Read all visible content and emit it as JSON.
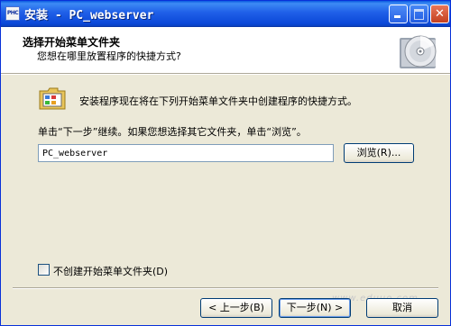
{
  "window": {
    "title": "安装 - PC_webserver",
    "app_icon_text": "PHC"
  },
  "header": {
    "title": "选择开始菜单文件夹",
    "subtitle": "您想在哪里放置程序的快捷方式?"
  },
  "body": {
    "info_text": "安装程序现在将在下列开始菜单文件夹中创建程序的快捷方式。",
    "instruction_text": "单击“下一步”继续。如果您想选择其它文件夹，单击“浏览”。",
    "folder_input_value": "PC_webserver",
    "browse_label": "浏览(R)...",
    "no_folder_checkbox_label": "不创建开始菜单文件夹(D)",
    "no_folder_checked": false
  },
  "footer": {
    "back_label": "< 上一步(B)",
    "next_label": "下一步(N) >",
    "cancel_label": "取消",
    "watermark": "www.eduuo.com"
  },
  "colors": {
    "titlebar": "#0a5ae0",
    "dialog_bg": "#ece9d8",
    "header_bg": "#ffffff"
  }
}
